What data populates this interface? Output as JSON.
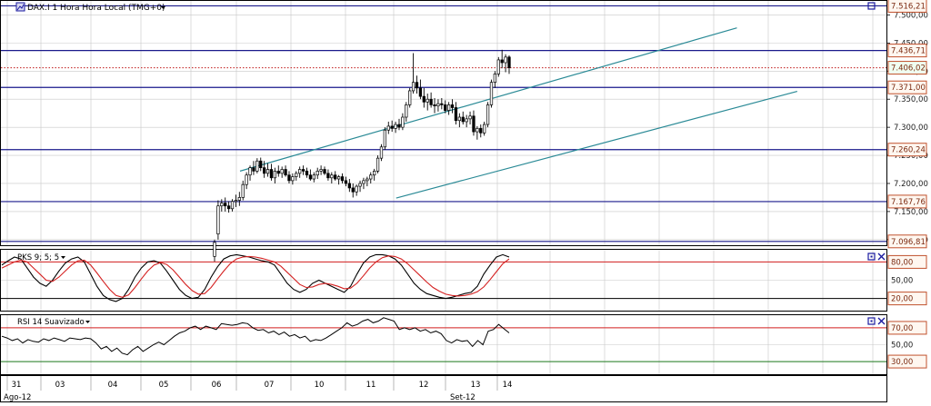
{
  "colors": {
    "frame": "#000000",
    "level_line": "#1a1a8c",
    "grid": "#c8c8c8",
    "channel": "#2a8a96",
    "osc_red": "#d42020",
    "osc_black": "#000000",
    "rsi_green": "#1e7a1e",
    "price_label_border": "#c0502c",
    "price_label_text": "#7a2a10",
    "icon_blue": "#1a1aa0",
    "last_price_dotted": "#c01818"
  },
  "main_panel": {
    "title": "DAX.I 1 Hora Hora Local (TMG+0)",
    "icon": "chart-icon",
    "menu_icon": "dropdown-arrow-icon"
  },
  "pks_panel": {
    "title": "PKS 9; 5; 5"
  },
  "rsi_panel": {
    "title": "RSI 14 Suavizado"
  },
  "axis": {
    "x_day_labels": [
      "31",
      "03",
      "04",
      "05",
      "06",
      "07",
      "10",
      "11",
      "12",
      "13",
      "14"
    ],
    "x_month_labels": [
      "Ago-12",
      "Set-12"
    ]
  },
  "chart_data": [
    {
      "type": "candlestick",
      "name": "DAX.I 1 Hora",
      "ylim": [
        7090,
        7525
      ],
      "y_ticks": [
        7500,
        7450,
        7400,
        7350,
        7300,
        7250,
        7200,
        7150,
        7100
      ],
      "y_tick_labels": [
        "7.500,00",
        "7.450,00",
        "7.400,00",
        "7.350,00",
        "7.300,00",
        "7.250,00",
        "7.200,00",
        "7.150,00",
        "7.100,00"
      ],
      "level_lines": [
        7516.21,
        7436.71,
        7371.0,
        7260.24,
        7167.76,
        7096.81
      ],
      "level_labels": [
        "7.516,21",
        "7.436,71",
        "7.371,00",
        "7.260,24",
        "7.167,76",
        "7.096,81"
      ],
      "last_price": 7406.02,
      "last_price_label": "7.406,02",
      "channel_upper": [
        [
          0,
          7222
        ],
        [
          140,
          7477
        ]
      ],
      "channel_lower": [
        [
          44,
          7174
        ],
        [
          157,
          7364
        ]
      ],
      "ohlc": [
        [
          7070,
          7100,
          7060,
          7095
        ],
        [
          7110,
          7170,
          7100,
          7160
        ],
        [
          7160,
          7172,
          7150,
          7165
        ],
        [
          7165,
          7175,
          7150,
          7160
        ],
        [
          7160,
          7168,
          7148,
          7155
        ],
        [
          7155,
          7172,
          7150,
          7168
        ],
        [
          7168,
          7180,
          7158,
          7170
        ],
        [
          7170,
          7185,
          7160,
          7175
        ],
        [
          7175,
          7205,
          7170,
          7198
        ],
        [
          7198,
          7220,
          7190,
          7215
        ],
        [
          7215,
          7232,
          7205,
          7228
        ],
        [
          7228,
          7240,
          7215,
          7222
        ],
        [
          7222,
          7245,
          7218,
          7240
        ],
        [
          7240,
          7246,
          7222,
          7228
        ],
        [
          7228,
          7240,
          7210,
          7218
        ],
        [
          7218,
          7236,
          7212,
          7225
        ],
        [
          7225,
          7235,
          7205,
          7210
        ],
        [
          7210,
          7228,
          7200,
          7222
        ],
        [
          7222,
          7232,
          7212,
          7218
        ],
        [
          7218,
          7230,
          7210,
          7225
        ],
        [
          7225,
          7232,
          7212,
          7215
        ],
        [
          7215,
          7222,
          7200,
          7205
        ],
        [
          7205,
          7218,
          7198,
          7212
        ],
        [
          7212,
          7222,
          7205,
          7218
        ],
        [
          7218,
          7230,
          7210,
          7225
        ],
        [
          7225,
          7232,
          7215,
          7222
        ],
        [
          7222,
          7228,
          7210,
          7215
        ],
        [
          7215,
          7225,
          7205,
          7208
        ],
        [
          7208,
          7220,
          7202,
          7215
        ],
        [
          7215,
          7228,
          7208,
          7222
        ],
        [
          7222,
          7232,
          7215,
          7225
        ],
        [
          7225,
          7230,
          7215,
          7218
        ],
        [
          7218,
          7225,
          7205,
          7210
        ],
        [
          7210,
          7220,
          7200,
          7215
        ],
        [
          7215,
          7222,
          7205,
          7208
        ],
        [
          7208,
          7215,
          7198,
          7212
        ],
        [
          7212,
          7218,
          7200,
          7205
        ],
        [
          7205,
          7212,
          7195,
          7200
        ],
        [
          7200,
          7208,
          7185,
          7192
        ],
        [
          7192,
          7200,
          7175,
          7185
        ],
        [
          7185,
          7198,
          7178,
          7195
        ],
        [
          7195,
          7205,
          7185,
          7200
        ],
        [
          7200,
          7210,
          7190,
          7205
        ],
        [
          7205,
          7212,
          7195,
          7208
        ],
        [
          7208,
          7220,
          7200,
          7215
        ],
        [
          7215,
          7226,
          7205,
          7222
        ],
        [
          7222,
          7250,
          7218,
          7245
        ],
        [
          7245,
          7270,
          7240,
          7265
        ],
        [
          7265,
          7300,
          7260,
          7295
        ],
        [
          7295,
          7310,
          7288,
          7302
        ],
        [
          7302,
          7312,
          7292,
          7298
        ],
        [
          7298,
          7310,
          7290,
          7305
        ],
        [
          7305,
          7315,
          7295,
          7300
        ],
        [
          7300,
          7325,
          7295,
          7318
        ],
        [
          7318,
          7345,
          7310,
          7340
        ],
        [
          7340,
          7370,
          7335,
          7365
        ],
        [
          7365,
          7432,
          7360,
          7380
        ],
        [
          7380,
          7392,
          7360,
          7370
        ],
        [
          7370,
          7385,
          7350,
          7355
        ],
        [
          7355,
          7370,
          7335,
          7345
        ],
        [
          7345,
          7360,
          7330,
          7350
        ],
        [
          7350,
          7362,
          7335,
          7340
        ],
        [
          7340,
          7352,
          7325,
          7338
        ],
        [
          7338,
          7350,
          7328,
          7342
        ],
        [
          7342,
          7352,
          7332,
          7340
        ],
        [
          7340,
          7348,
          7325,
          7330
        ],
        [
          7330,
          7345,
          7322,
          7340
        ],
        [
          7340,
          7350,
          7325,
          7335
        ],
        [
          7335,
          7345,
          7305,
          7312
        ],
        [
          7312,
          7325,
          7300,
          7318
        ],
        [
          7318,
          7328,
          7305,
          7310
        ],
        [
          7310,
          7322,
          7300,
          7315
        ],
        [
          7315,
          7328,
          7305,
          7320
        ],
        [
          7320,
          7330,
          7285,
          7292
        ],
        [
          7292,
          7302,
          7278,
          7298
        ],
        [
          7298,
          7305,
          7282,
          7290
        ],
        [
          7290,
          7310,
          7285,
          7305
        ],
        [
          7305,
          7345,
          7300,
          7340
        ],
        [
          7340,
          7385,
          7335,
          7380
        ],
        [
          7380,
          7400,
          7370,
          7395
        ],
        [
          7395,
          7425,
          7390,
          7420
        ],
        [
          7420,
          7438,
          7405,
          7415
        ],
        [
          7415,
          7430,
          7398,
          7425
        ],
        [
          7425,
          7428,
          7395,
          7406
        ]
      ]
    },
    {
      "type": "line",
      "name": "PKS 9; 5; 5",
      "ylim": [
        0,
        100
      ],
      "y_tick_labels": [
        "80,00",
        "50,00",
        "20,00"
      ],
      "y_ticks": [
        80,
        50,
        20
      ],
      "reference_lines": [
        80,
        20
      ],
      "series": [
        {
          "values": [
            75,
            82,
            88,
            85,
            70,
            55,
            45,
            40,
            50,
            65,
            78,
            85,
            88,
            80,
            60,
            40,
            25,
            18,
            15,
            20,
            35,
            55,
            70,
            80,
            82,
            78,
            65,
            50,
            35,
            25,
            20,
            22,
            35,
            55,
            72,
            85,
            90,
            92,
            90,
            88,
            85,
            82,
            80,
            75,
            60,
            45,
            35,
            30,
            35,
            45,
            50,
            45,
            40,
            35,
            30,
            40,
            60,
            78,
            88,
            92,
            92,
            90,
            85,
            75,
            60,
            45,
            35,
            28,
            25,
            22,
            20,
            22,
            25,
            28,
            30,
            40,
            60,
            75,
            88,
            92,
            88
          ]
        },
        {
          "values": [
            70,
            75,
            80,
            83,
            80,
            70,
            60,
            50,
            48,
            55,
            65,
            75,
            82,
            83,
            75,
            62,
            48,
            35,
            25,
            22,
            26,
            38,
            52,
            65,
            75,
            79,
            76,
            67,
            55,
            43,
            33,
            27,
            28,
            38,
            52,
            65,
            77,
            85,
            88,
            89,
            88,
            86,
            83,
            80,
            73,
            63,
            53,
            43,
            38,
            39,
            43,
            45,
            43,
            40,
            36,
            37,
            45,
            57,
            70,
            80,
            87,
            90,
            89,
            85,
            77,
            67,
            57,
            47,
            38,
            32,
            27,
            25,
            24,
            25,
            27,
            31,
            39,
            51,
            64,
            77,
            85
          ]
        }
      ]
    },
    {
      "type": "line",
      "name": "RSI 14 Suavizado",
      "ylim": [
        15,
        85
      ],
      "y_tick_labels": [
        "70,00",
        "50,00",
        "30,00"
      ],
      "y_ticks": [
        70,
        50,
        30
      ],
      "reference_lines": [
        70,
        30
      ],
      "series": [
        {
          "values": [
            60,
            58,
            55,
            57,
            52,
            56,
            54,
            53,
            57,
            55,
            58,
            56,
            54,
            58,
            57,
            56,
            58,
            57,
            52,
            45,
            48,
            42,
            46,
            40,
            38,
            44,
            48,
            42,
            46,
            50,
            53,
            50,
            55,
            60,
            64,
            66,
            70,
            72,
            68,
            72,
            70,
            68,
            75,
            74,
            73,
            74,
            76,
            75,
            70,
            67,
            68,
            64,
            66,
            62,
            65,
            60,
            62,
            58,
            60,
            54,
            56,
            55,
            58,
            62,
            66,
            70,
            76,
            72,
            74,
            78,
            80,
            76,
            78,
            82,
            80,
            78,
            68,
            70,
            68,
            70,
            66,
            68,
            64,
            66,
            63,
            55,
            52,
            56,
            54,
            55,
            48,
            55,
            50,
            66,
            68,
            74,
            69,
            64
          ]
        }
      ]
    }
  ]
}
